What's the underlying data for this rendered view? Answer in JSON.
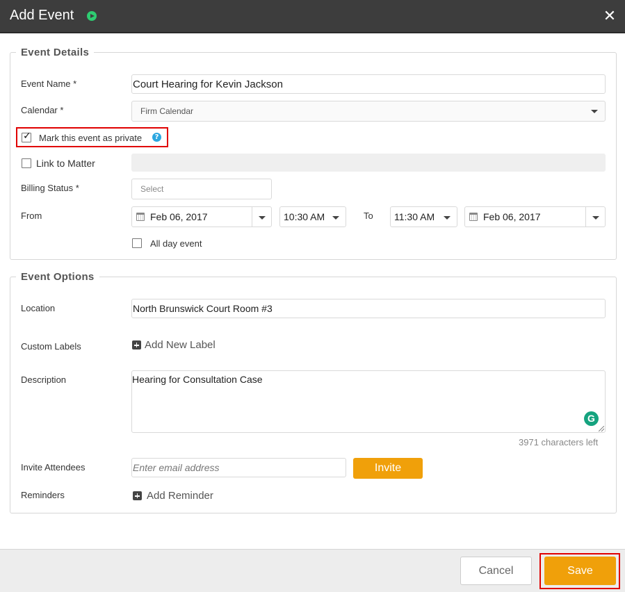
{
  "dialog": {
    "title": "Add Event"
  },
  "event_details": {
    "legend": "Event Details",
    "event_name_label": "Event Name *",
    "event_name_value": "Court Hearing for Kevin Jackson",
    "calendar_label": "Calendar *",
    "calendar_value": "Firm Calendar",
    "private_label": "Mark this event as private",
    "private_checked": true,
    "help_glyph": "?",
    "link_matter_label": "Link to Matter",
    "link_matter_checked": false,
    "billing_label": "Billing Status *",
    "billing_placeholder": "Select",
    "from_label": "From",
    "from_date": "Feb 06, 2017",
    "from_time": "10:30 AM",
    "to_label": "To",
    "to_time": "11:30 AM",
    "to_date": "Feb 06, 2017",
    "all_day_label": "All day event",
    "all_day_checked": false
  },
  "event_options": {
    "legend": "Event Options",
    "location_label": "Location",
    "location_value": "North Brunswick Court Room #3",
    "custom_labels_label": "Custom Labels",
    "add_label_text": "Add New Label",
    "description_label": "Description",
    "description_value": "Hearing for Consultation Case",
    "chars_left": "3971 characters left",
    "grammarly_glyph": "G",
    "invite_label": "Invite Attendees",
    "invite_placeholder": "Enter email address",
    "invite_button": "Invite",
    "reminders_label": "Reminders",
    "add_reminder_text": "Add Reminder"
  },
  "footer": {
    "cancel_label": "Cancel",
    "save_label": "Save"
  },
  "colors": {
    "header_bg": "#3d3d3d",
    "accent_orange": "#f0a00a",
    "highlight_red": "#e00000",
    "play_green": "#2ecc71",
    "help_blue": "#2ca7e0"
  }
}
